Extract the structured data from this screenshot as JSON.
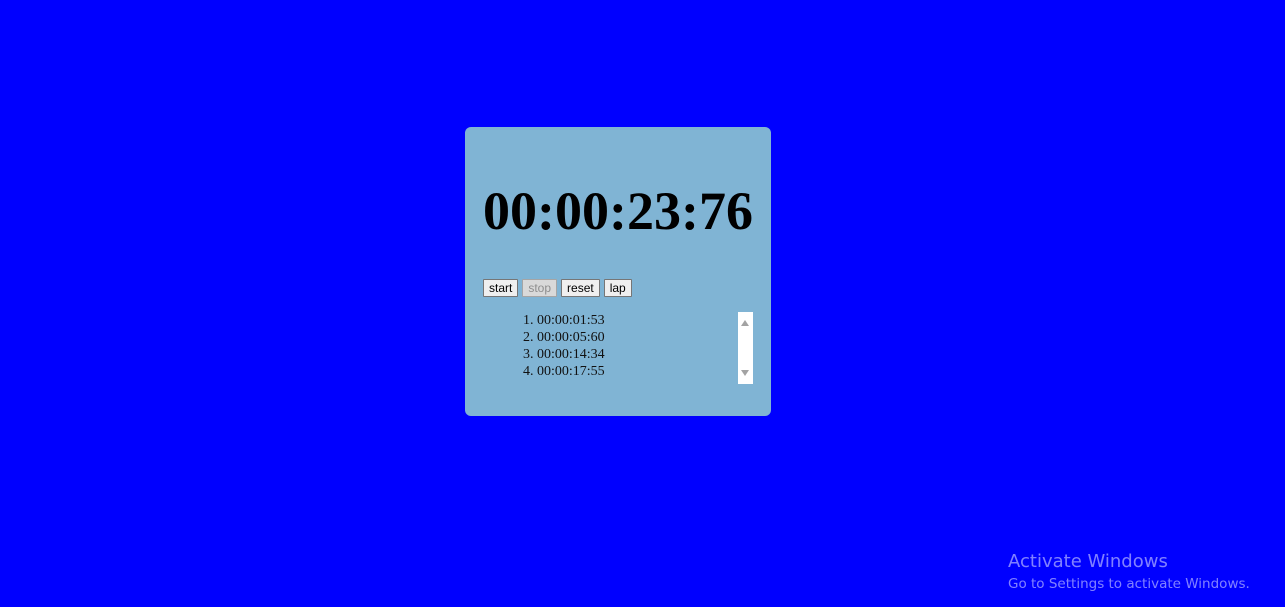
{
  "stopwatch": {
    "time": "00:00:23:76",
    "buttons": {
      "start": "start",
      "stop": "stop",
      "reset": "reset",
      "lap": "lap"
    },
    "laps": [
      "00:00:01:53",
      "00:00:05:60",
      "00:00:14:34",
      "00:00:17:55"
    ]
  },
  "watermark": {
    "title": "Activate Windows",
    "subtitle": "Go to Settings to activate Windows."
  },
  "colors": {
    "background": "#0000ff",
    "card": "#80b4d4"
  }
}
